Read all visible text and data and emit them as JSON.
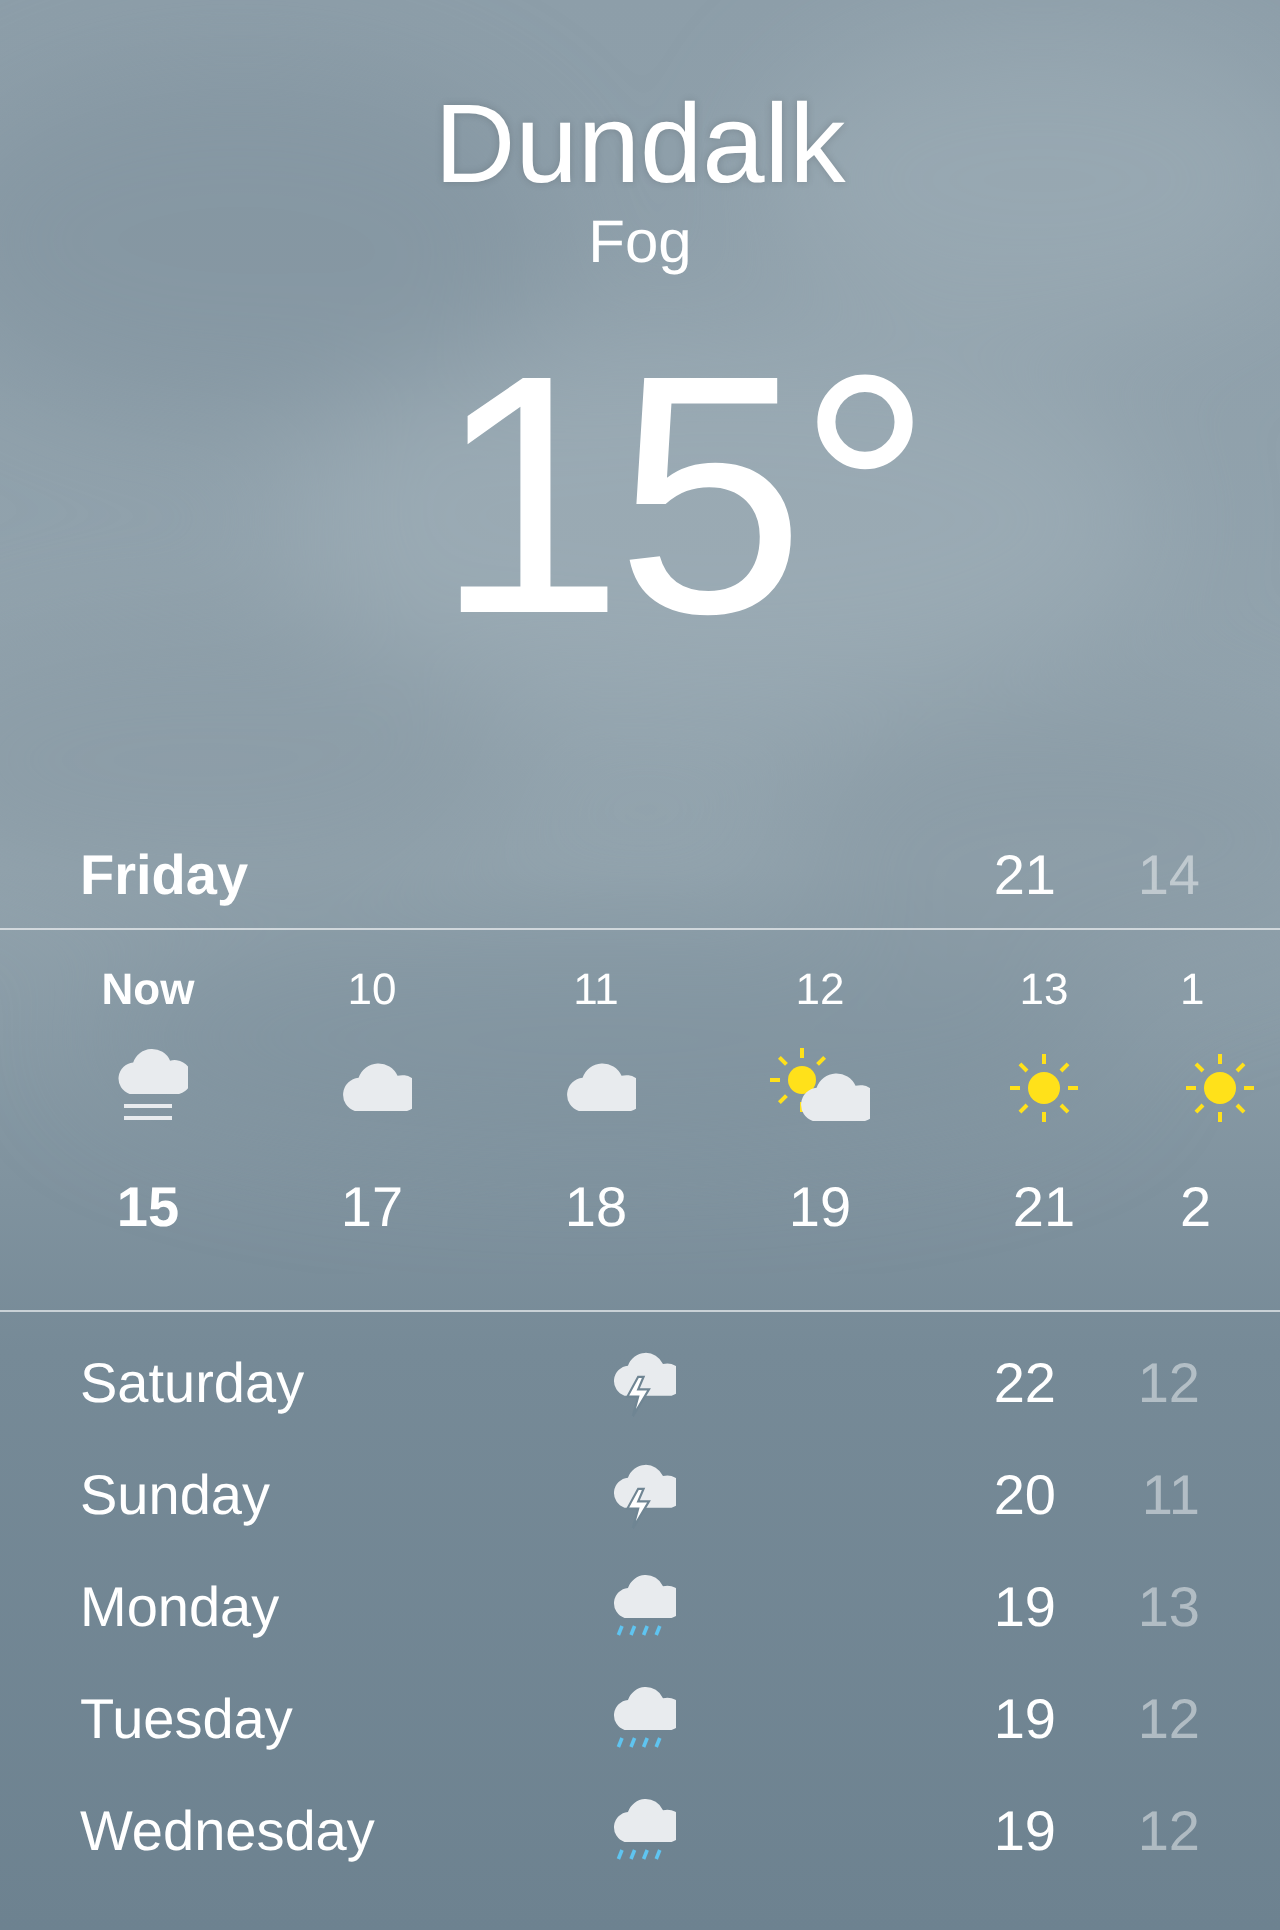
{
  "location": {
    "city": "Dundalk",
    "condition": "Fog",
    "temperature": "15°"
  },
  "today": {
    "day": "Friday",
    "high": "21",
    "low": "14"
  },
  "hourly": [
    {
      "time": "Now",
      "kind": "fog",
      "temp": "15",
      "current": true
    },
    {
      "time": "10",
      "kind": "cloudy",
      "temp": "17",
      "current": false
    },
    {
      "time": "11",
      "kind": "cloudy",
      "temp": "18",
      "current": false
    },
    {
      "time": "12",
      "kind": "partly-sunny",
      "temp": "19",
      "current": false
    },
    {
      "time": "13",
      "kind": "sunny",
      "temp": "21",
      "current": false
    },
    {
      "time": "1",
      "kind": "sunny",
      "temp": "2",
      "current": false
    }
  ],
  "daily": [
    {
      "day": "Saturday",
      "kind": "thunder",
      "high": "22",
      "low": "12"
    },
    {
      "day": "Sunday",
      "kind": "thunder",
      "high": "20",
      "low": "11"
    },
    {
      "day": "Monday",
      "kind": "rain",
      "high": "19",
      "low": "13"
    },
    {
      "day": "Tuesday",
      "kind": "rain",
      "high": "19",
      "low": "12"
    },
    {
      "day": "Wednesday",
      "kind": "rain",
      "high": "19",
      "low": "12"
    }
  ]
}
